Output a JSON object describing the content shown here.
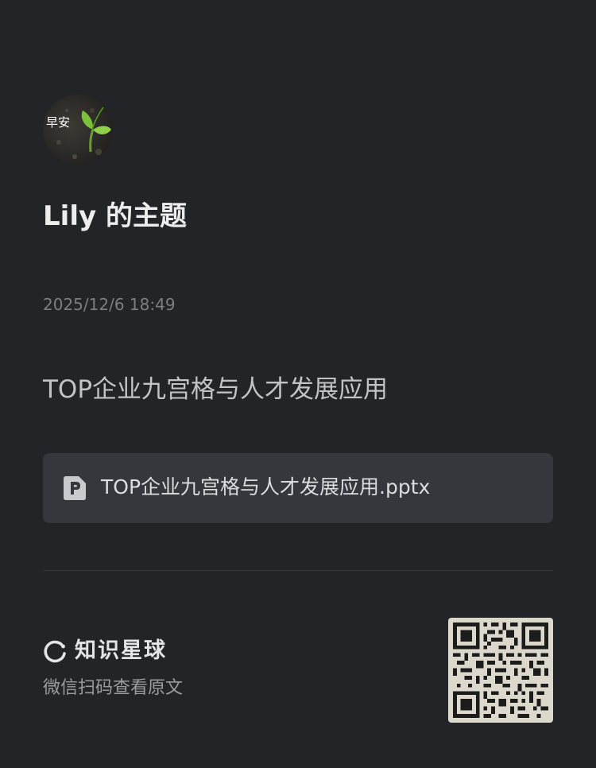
{
  "author": {
    "avatar_icon": "seedling-avatar-icon",
    "avatar_text": "早安"
  },
  "topic": {
    "title": "Lily 的主题",
    "timestamp": "2025/12/6 18:49",
    "content_title": "TOP企业九宫格与人才发展应用"
  },
  "attachment": {
    "icon": "ppt-file-icon",
    "file_name": "TOP企业九宫格与人才发展应用.pptx"
  },
  "footer": {
    "brand_icon": "planet-circle-icon",
    "brand_name": "知识星球",
    "hint": "微信扫码查看原文",
    "qr_icon": "qr-code-icon"
  },
  "colors": {
    "background": "#232428",
    "card": "#36373c",
    "title_text": "#ededed",
    "muted_text": "#7d7e83",
    "qr_background": "#ddd8cc"
  }
}
